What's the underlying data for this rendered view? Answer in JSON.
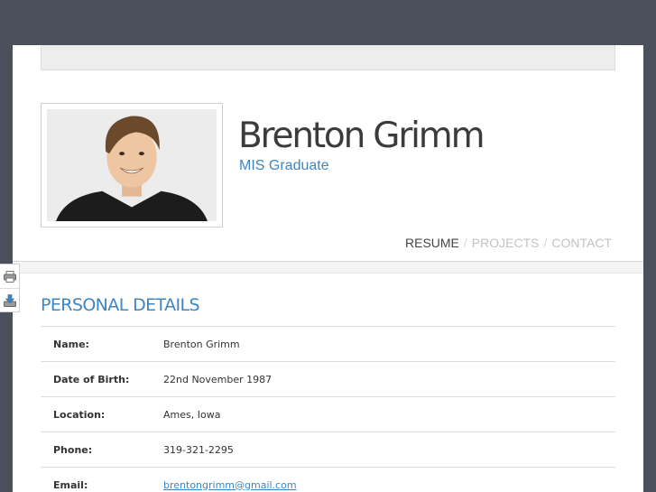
{
  "profile": {
    "name": "Brenton Grimm",
    "subtitle": "MIS Graduate"
  },
  "nav": {
    "items": [
      {
        "label": "RESUME",
        "active": true
      },
      {
        "label": "PROJECTS",
        "active": false
      },
      {
        "label": "CONTACT",
        "active": false
      }
    ],
    "separator": "/"
  },
  "side_tools": [
    "print-icon",
    "download-icon"
  ],
  "personal_details": {
    "title": "PERSONAL DETAILS",
    "rows": [
      {
        "label": "Name:",
        "value": "Brenton Grimm"
      },
      {
        "label": "Date of Birth:",
        "value": "22nd November 1987"
      },
      {
        "label": "Location:",
        "value": "Ames, Iowa"
      },
      {
        "label": "Phone:",
        "value": "319-321-2295"
      },
      {
        "label": "Email:",
        "value": "brentongrimm@gmail.com"
      }
    ]
  },
  "colors": {
    "background": "#4a515c",
    "accent": "#3f86c1",
    "heading": "#3b3b3b"
  }
}
